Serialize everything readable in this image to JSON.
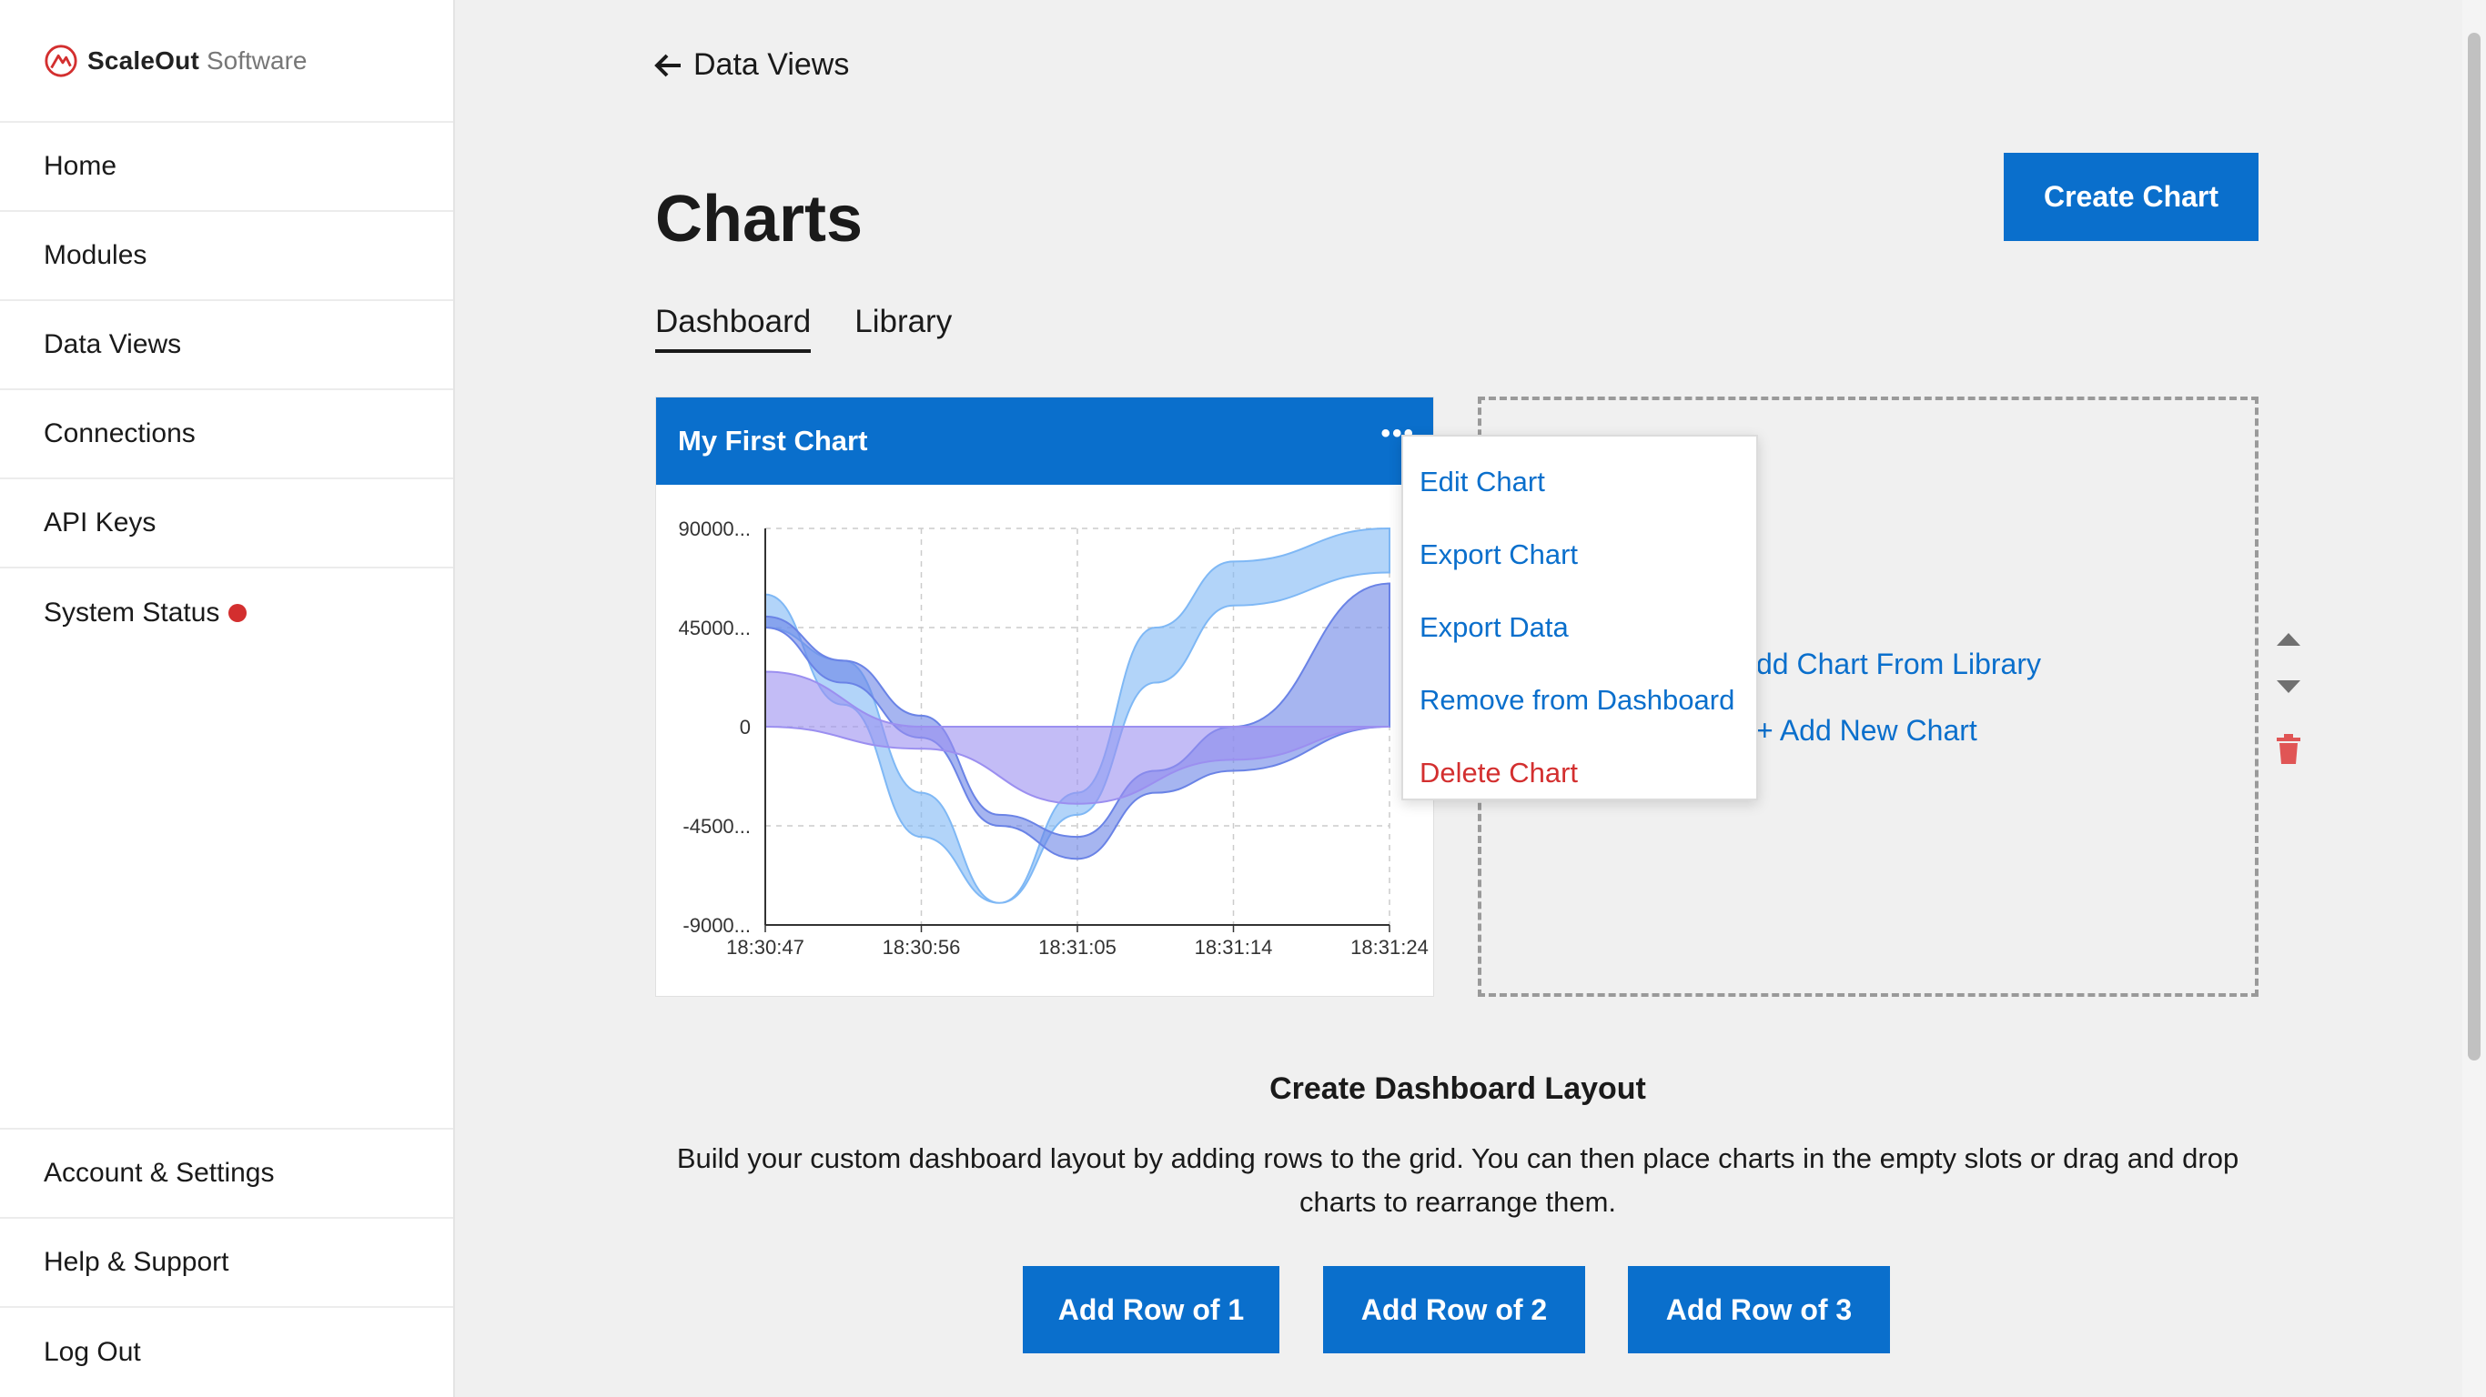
{
  "app": {
    "brand_name": "ScaleOut",
    "brand_suffix": "Software",
    "accent_color": "#0a6fcc"
  },
  "sidebar": {
    "items": [
      {
        "label": "Home"
      },
      {
        "label": "Modules"
      },
      {
        "label": "Data Views"
      },
      {
        "label": "Connections"
      },
      {
        "label": "API Keys"
      },
      {
        "label": "System Status",
        "status_color": "#d32f2f"
      }
    ],
    "bottom_items": [
      {
        "label": "Account & Settings"
      },
      {
        "label": "Help & Support"
      },
      {
        "label": "Log Out"
      }
    ]
  },
  "header": {
    "back_label": "Data Views",
    "title": "Charts",
    "create_button": "Create Chart"
  },
  "tabs": [
    {
      "label": "Dashboard",
      "active": true
    },
    {
      "label": "Library",
      "active": false
    }
  ],
  "chart_card": {
    "title": "My First Chart",
    "menu_icon": "more-horizontal-icon"
  },
  "chart_data": {
    "type": "area",
    "title": "",
    "x_ticks": [
      "18:30:47",
      "18:30:56",
      "18:31:05",
      "18:31:14",
      "18:31:24"
    ],
    "y_ticks": [
      "90000...",
      "45000...",
      "0",
      "-4500...",
      "-9000..."
    ],
    "ylim": [
      -90000,
      90000
    ],
    "grid": true,
    "series": [
      {
        "color": "#7fb8f5",
        "points": [
          [
            0,
            60000
          ],
          [
            0.5,
            10000
          ],
          [
            1,
            -50000
          ],
          [
            1.5,
            -80000
          ],
          [
            2,
            -30000
          ],
          [
            2.5,
            45000
          ],
          [
            3,
            75000
          ],
          [
            4,
            90000
          ]
        ],
        "lower": [
          [
            0,
            45000
          ],
          [
            0.5,
            30000
          ],
          [
            1,
            -30000
          ],
          [
            1.5,
            -80000
          ],
          [
            2,
            -40000
          ],
          [
            2.5,
            20000
          ],
          [
            3,
            55000
          ],
          [
            4,
            70000
          ]
        ]
      },
      {
        "color": "#6a83e6",
        "points": [
          [
            0,
            50000
          ],
          [
            0.5,
            30000
          ],
          [
            1,
            5000
          ],
          [
            1.5,
            -40000
          ],
          [
            2,
            -50000
          ],
          [
            2.5,
            -20000
          ],
          [
            3,
            0
          ],
          [
            4,
            65000
          ]
        ],
        "lower": [
          [
            0,
            45000
          ],
          [
            0.5,
            20000
          ],
          [
            1,
            -5000
          ],
          [
            1.5,
            -45000
          ],
          [
            2,
            -60000
          ],
          [
            2.5,
            -30000
          ],
          [
            3,
            -20000
          ],
          [
            4,
            0
          ]
        ]
      },
      {
        "color": "#9b8ff0",
        "points": [
          [
            0,
            25000
          ],
          [
            1,
            0
          ],
          [
            2,
            0
          ],
          [
            3,
            0
          ],
          [
            4,
            0
          ]
        ],
        "lower": [
          [
            0,
            0
          ],
          [
            1,
            -10000
          ],
          [
            2,
            -35000
          ],
          [
            3,
            -15000
          ],
          [
            4,
            0
          ]
        ]
      }
    ]
  },
  "context_menu": {
    "items": [
      {
        "label": "Edit Chart"
      },
      {
        "label": "Export Chart"
      },
      {
        "label": "Export Data"
      },
      {
        "label": "Remove from Dashboard"
      },
      {
        "label": "Delete Chart",
        "danger": true
      }
    ]
  },
  "empty_slot": {
    "add_from_library": "dd Chart From Library",
    "add_new": "+ Add New Chart"
  },
  "layout": {
    "title": "Create Dashboard Layout",
    "description": "Build your custom dashboard layout by adding rows to the grid. You can then place charts in the empty slots or drag and drop charts to rearrange them.",
    "buttons": [
      "Add Row of 1",
      "Add Row of 2",
      "Add Row of 3"
    ]
  }
}
